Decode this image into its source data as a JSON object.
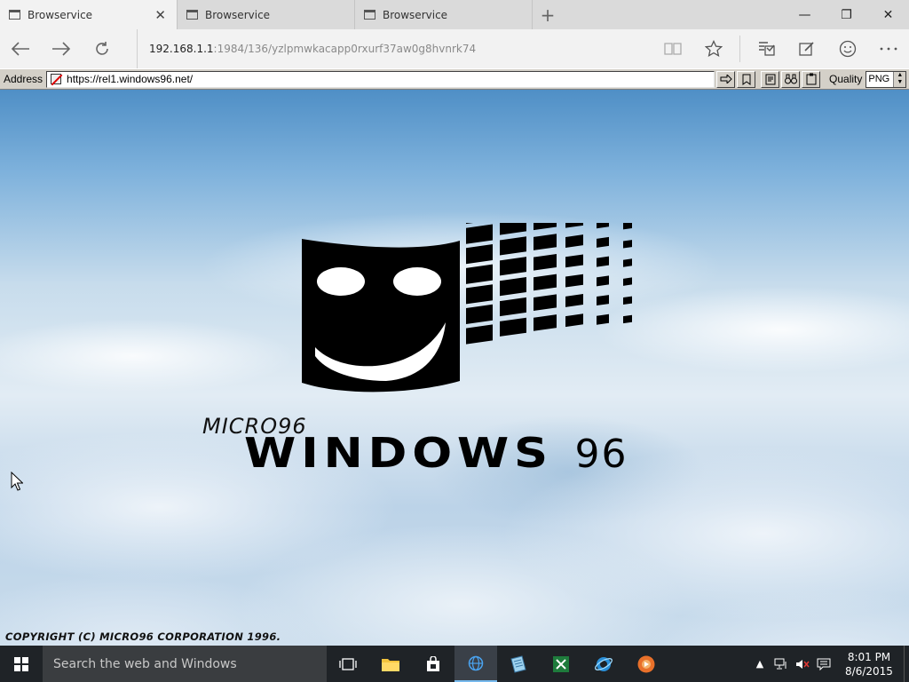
{
  "tabs": [
    {
      "label": "Browservice",
      "active": true
    },
    {
      "label": "Browservice",
      "active": false
    },
    {
      "label": "Browservice",
      "active": false
    }
  ],
  "window_controls": {
    "minimize": "—",
    "restore": "❐",
    "close": "✕"
  },
  "navbar": {
    "url_host": "192.168.1.1",
    "url_rest": ":1984/136/yzlpmwkacapp0rxurf37aw0g8hvnrk74"
  },
  "browservice": {
    "address_label": "Address",
    "address_value": "https://rel1.windows96.net/",
    "quality_label": "Quality",
    "quality_value": "PNG"
  },
  "page": {
    "brand_top": "MICRO96",
    "brand_main": "WINDOWS",
    "brand_num": "96",
    "copyright": "COPYRIGHT (C) MICRO96 CORPORATION 1996."
  },
  "taskbar": {
    "search_placeholder": "Search the web and Windows",
    "time": "8:01 PM",
    "date": "8/6/2015"
  },
  "colors": {
    "taskbar": "#1f2327",
    "tab_strip": "#dadada",
    "accent": "#76b9ed"
  }
}
